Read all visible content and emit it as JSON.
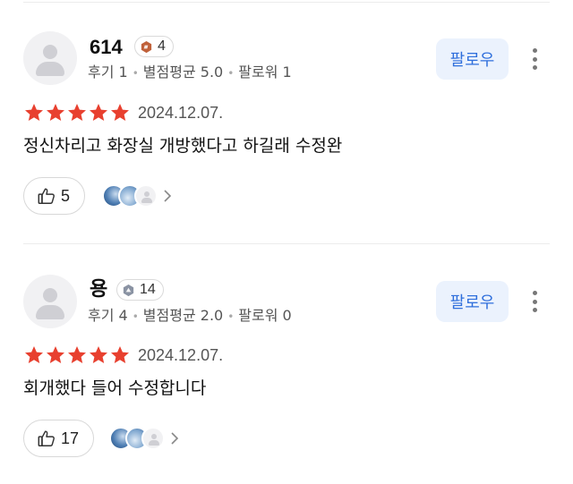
{
  "reviews": [
    {
      "name": "614",
      "level": "4",
      "level_color": "#c0613a",
      "stats": {
        "reviews": "후기 1",
        "avg": "별점평균 5.0",
        "followers": "팔로워 1"
      },
      "follow_label": "팔로우",
      "rating": 5,
      "date": "2024.12.07.",
      "text": "정신차리고 화장실 개방했다고 하길래 수정완",
      "likes": "5"
    },
    {
      "name": "용",
      "level": "14",
      "level_color": "#8a93a3",
      "stats": {
        "reviews": "후기 4",
        "avg": "별점평균 2.0",
        "followers": "팔로워 0"
      },
      "follow_label": "팔로우",
      "rating": 5,
      "date": "2024.12.07.",
      "text": "회개했다 들어 수정합니다",
      "likes": "17"
    }
  ],
  "colors": {
    "star": "#e8402f",
    "follow_text": "#2f6fdc",
    "follow_bg": "#ebf2fd"
  },
  "icons": {
    "avatar": "default-user-icon",
    "like": "thumbs-up-icon",
    "more": "more-vertical-icon",
    "chevron": "chevron-right-icon"
  }
}
